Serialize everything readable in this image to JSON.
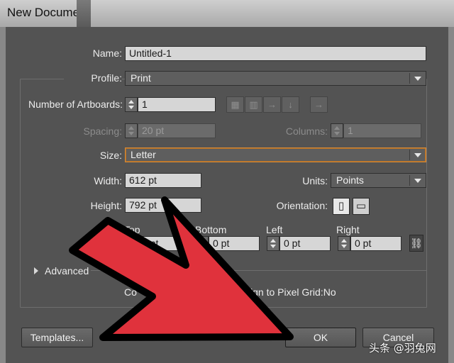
{
  "window": {
    "title": "New Document"
  },
  "form": {
    "name_label": "Name:",
    "name_value": "Untitled-1",
    "profile_label": "Profile:",
    "profile_value": "Print",
    "artboards_label": "Number of Artboards:",
    "artboards_value": "1",
    "spacing_label": "Spacing:",
    "spacing_value": "20 pt",
    "columns_label": "Columns:",
    "columns_value": "1",
    "size_label": "Size:",
    "size_value": "Letter",
    "width_label": "Width:",
    "width_value": "612 pt",
    "units_label": "Units:",
    "units_value": "Points",
    "height_label": "Height:",
    "height_value": "792 pt",
    "orientation_label": "Orientation:",
    "bleed": {
      "top_label": "Top",
      "top_value": "0 pt",
      "bottom_label": "Bottom",
      "bottom_value": "0 pt",
      "left_label": "Left",
      "left_value": "0 pt",
      "right_label": "Right",
      "right_value": "0 pt"
    },
    "advanced_label": "Advanced",
    "color_mode_partial": "Co",
    "align_pixel_grid": "ign to Pixel Grid:No"
  },
  "buttons": {
    "templates": "Templates...",
    "ok": "OK",
    "cancel": "Cancel"
  },
  "icons": {
    "artboard_grid_row": "grid-by-row-icon",
    "artboard_grid_column": "grid-by-column-icon",
    "artboard_row": "arrange-by-row-icon",
    "artboard_column": "arrange-by-column-icon",
    "artboard_direction": "right-to-left-icon",
    "portrait": "portrait-icon",
    "landscape": "landscape-icon",
    "link": "chain-link-icon",
    "overlay_arrow": "red-arrow-overlay"
  },
  "colors": {
    "overlay_arrow": "#e0323c",
    "focus_border": "#d48a3a"
  },
  "watermark": "头条 @羽兔网"
}
